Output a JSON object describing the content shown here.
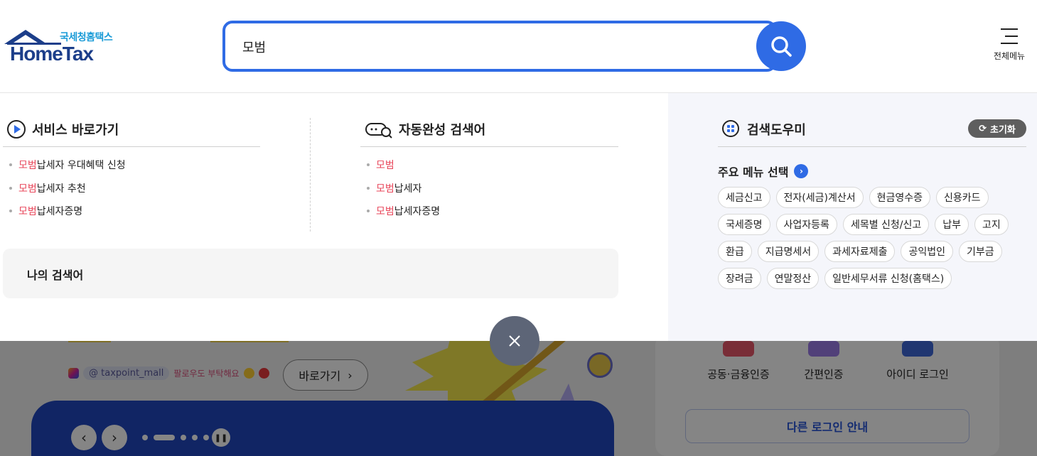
{
  "header": {
    "logo_sub": "국세청홈택스",
    "logo_main": "HomeTax",
    "search_value": "모범",
    "all_menu_label": "전체메뉴"
  },
  "services": {
    "title": "서비스 바로가기",
    "items": [
      {
        "kw": "모범",
        "rest": "납세자 우대혜택 신청"
      },
      {
        "kw": "모범",
        "rest": "납세자 추천"
      },
      {
        "kw": "모범",
        "rest": "납세자증명"
      }
    ]
  },
  "autocomplete": {
    "title": "자동완성 검색어",
    "items": [
      {
        "kw": "모범",
        "rest": ""
      },
      {
        "kw": "모범",
        "rest": "납세자"
      },
      {
        "kw": "모범",
        "rest": "납세자증명"
      }
    ]
  },
  "my_search": {
    "title": "나의 검색어"
  },
  "helper": {
    "title": "검색도우미",
    "reset_label": "초기화",
    "major_label": "주요 메뉴 선택",
    "tags": [
      [
        "세금신고",
        "전자(세금)계산서",
        "현금영수증",
        "신용카드"
      ],
      [
        "국세증명",
        "사업자등록",
        "세목별 신청/신고",
        "납부",
        "고지"
      ],
      [
        "환급",
        "지급명세서",
        "과세자료제출",
        "공익법인",
        "기부금"
      ],
      [
        "장려금",
        "연말정산",
        "일반세무서류 신청(홈택스)"
      ]
    ]
  },
  "background": {
    "insta_handle": "@ taxpoint_mall",
    "insta_follow": "팔로우도 부탁해요",
    "go_button": "바로가기",
    "login_options": [
      "공동·금융인증",
      "간편인증",
      "아이디 로그인"
    ],
    "login_guide": "다른 로그인 안내"
  },
  "colors": {
    "accent": "#2f6be5",
    "keyword": "#e8465a",
    "logo": "#1c3e8a"
  }
}
